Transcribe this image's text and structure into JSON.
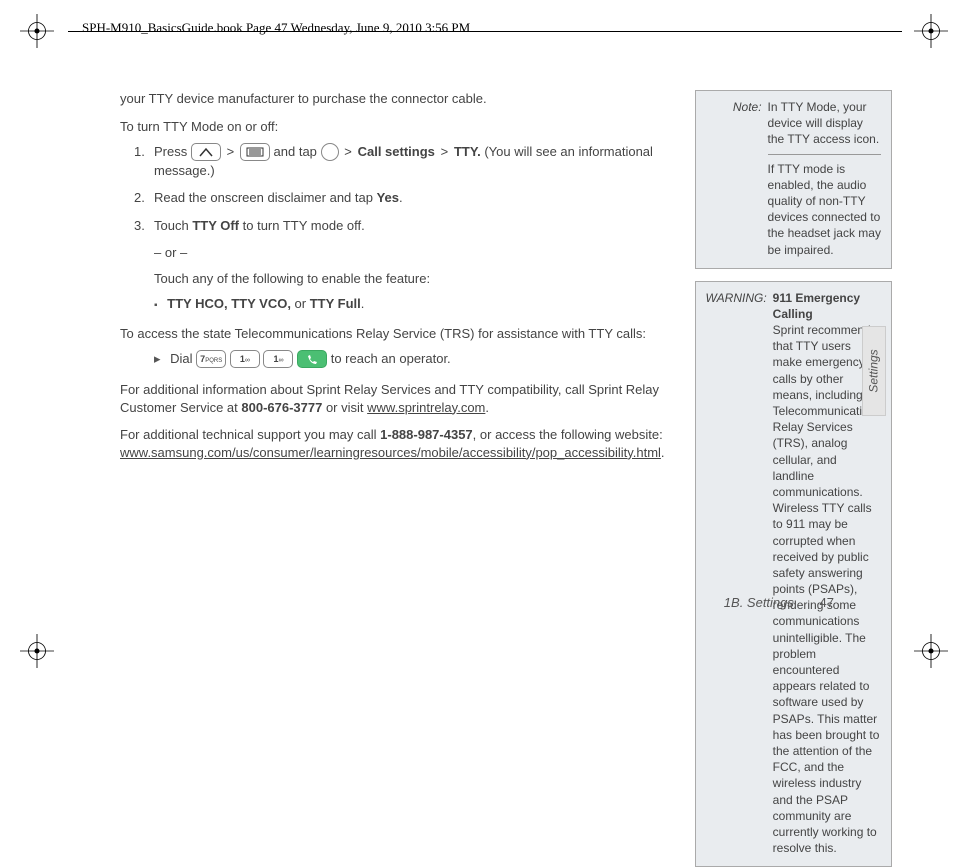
{
  "header": "SPH-M910_BasicsGuide.book  Page 47  Wednesday, June 9, 2010  3:56 PM",
  "left": {
    "p1": "your TTY device manufacturer to purchase the connector cable.",
    "subhead1": "To turn TTY Mode on or off:",
    "step1_a": "Press ",
    "step1_b": " and tap ",
    "step1_c": "Call settings",
    "step1_d": "TTY.",
    "step1_e": " (You will see an informational message.)",
    "step2_a": "Read the onscreen disclaimer and tap ",
    "step2_b": "Yes",
    "step3_a": "Touch ",
    "step3_b": "TTY Off",
    "step3_c": " to turn TTY mode off.",
    "or": "– or –",
    "touch_any": "Touch any of the following to enable the feature:",
    "opts": "TTY HCO, TTY VCO,",
    "opts_or": " or ",
    "opts_last": "TTY Full",
    "subhead2": "To access the state Telecommunications Relay Service (TRS) for assistance with TTY calls:",
    "dial_a": "Dial ",
    "dial_b": " to reach an operator.",
    "key7": "7PQRS",
    "key1a": "1",
    "key1b": "1",
    "p_sprint_a": "For additional information about Sprint Relay Services and TTY compatibility, call Sprint Relay Customer Service at ",
    "p_sprint_phone": "800-676-3777",
    "p_sprint_b": " or visit ",
    "p_sprint_link": "www.sprintrelay.com",
    "p_tech_a": "For additional technical support you may call ",
    "p_tech_phone": "1-888-987-4357",
    "p_tech_b": ", or access the following website: ",
    "p_tech_link": "www.samsung.com/us/consumer/learningresources/mobile/accessibility/pop_accessibility.html"
  },
  "note": {
    "label": "Note:",
    "p1": "In TTY Mode, your device will display the TTY access icon.",
    "p2": "If TTY mode is enabled, the audio quality of non-TTY devices connected to the headset jack may be impaired."
  },
  "warning": {
    "label": "WARNING:",
    "title": "911 Emergency Calling",
    "body": "Sprint recommends that TTY users make emergency calls by other means, including Telecommunications Relay Services (TRS), analog cellular, and landline communications. Wireless TTY calls to 911 may be corrupted when received by public safety answering points (PSAPs), rendering some communications unintelligible. The problem encountered appears related to software used by PSAPs. This matter has been brought to the attention of the FCC, and the wireless industry and the PSAP community are currently working to resolve this."
  },
  "sidetab": "Settings",
  "footer": {
    "section": "1B. Settings",
    "page": "47"
  }
}
